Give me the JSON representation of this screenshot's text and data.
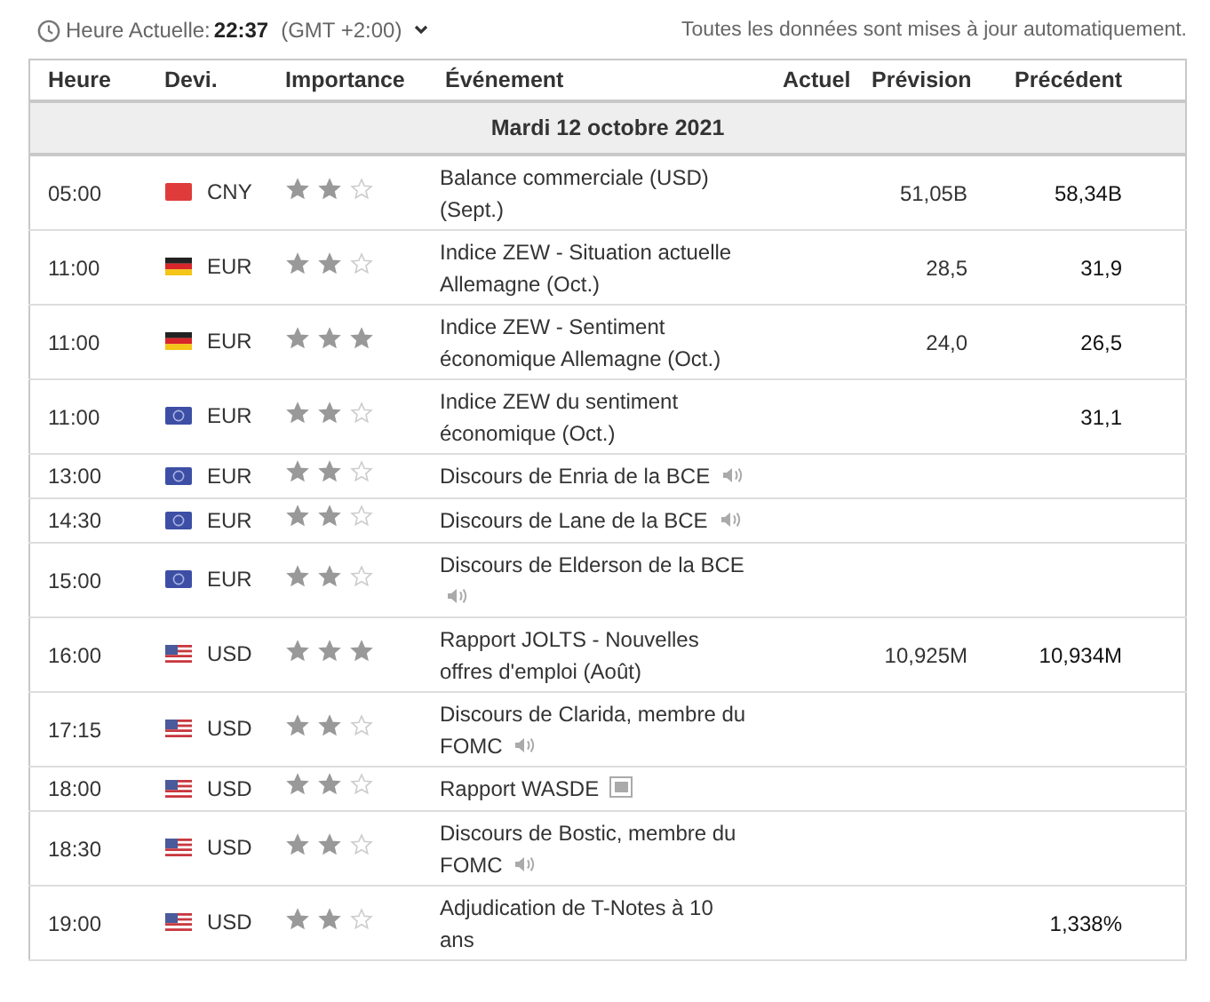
{
  "top_bar": {
    "clock_label": "Heure Actuelle:",
    "time": "22:37",
    "timezone": "(GMT +2:00)",
    "notice": "Toutes les données sont mises à jour automatiquement."
  },
  "table": {
    "columns": [
      "Heure",
      "Devi.",
      "Importance",
      "Événement",
      "Actuel",
      "Prévision",
      "Précédent"
    ],
    "date_header": "Mardi 12 octobre 2021",
    "rows": [
      {
        "time": "05:00",
        "currency": {
          "code": "CNY",
          "kind": "china"
        },
        "stars": 2,
        "event": {
          "text": "Balance commerciale (USD) (Sept.)",
          "kind": "plain"
        },
        "forecast": "51,05B",
        "previous": "58,34B"
      },
      {
        "time": "11:00",
        "currency": {
          "code": "EUR",
          "kind": "germany"
        },
        "stars": 2,
        "event": {
          "text": "Indice ZEW - Situation actuelle Allemagne (Oct.)",
          "kind": "plain"
        },
        "forecast": "28,5",
        "previous": "31,9"
      },
      {
        "time": "11:00",
        "currency": {
          "code": "EUR",
          "kind": "germany"
        },
        "stars": 3,
        "event": {
          "text": "Indice ZEW - Sentiment économique Allemagne (Oct.)",
          "kind": "plain"
        },
        "forecast": "24,0",
        "previous": "26,5"
      },
      {
        "time": "11:00",
        "currency": {
          "code": "EUR",
          "kind": "eu"
        },
        "stars": 2,
        "event": {
          "text": "Indice ZEW du sentiment économique (Oct.)",
          "kind": "plain"
        },
        "previous": "31,1"
      },
      {
        "time": "13:00",
        "currency": {
          "code": "EUR",
          "kind": "eu"
        },
        "stars": 2,
        "event": {
          "text": "Discours de Enria de la BCE",
          "kind": "speech"
        }
      },
      {
        "time": "14:30",
        "currency": {
          "code": "EUR",
          "kind": "eu"
        },
        "stars": 2,
        "event": {
          "text": "Discours de Lane de la BCE",
          "kind": "speech"
        }
      },
      {
        "time": "15:00",
        "currency": {
          "code": "EUR",
          "kind": "eu"
        },
        "stars": 2,
        "event": {
          "text": "Discours de Elderson de la BCE",
          "kind": "speech"
        }
      },
      {
        "time": "16:00",
        "currency": {
          "code": "USD",
          "kind": "usa"
        },
        "stars": 3,
        "event": {
          "text": "Rapport JOLTS - Nouvelles offres d'emploi (Août)",
          "kind": "plain"
        },
        "forecast": "10,925M",
        "previous": "10,934M"
      },
      {
        "time": "17:15",
        "currency": {
          "code": "USD",
          "kind": "usa"
        },
        "stars": 2,
        "event": {
          "text": "Discours de Clarida, membre du FOMC",
          "kind": "speech"
        }
      },
      {
        "time": "18:00",
        "currency": {
          "code": "USD",
          "kind": "usa"
        },
        "stars": 2,
        "event": {
          "text": "Rapport WASDE",
          "kind": "report"
        }
      },
      {
        "time": "18:30",
        "currency": {
          "code": "USD",
          "kind": "usa"
        },
        "stars": 2,
        "event": {
          "text": "Discours de Bostic, membre du FOMC",
          "kind": "speech"
        }
      },
      {
        "time": "19:00",
        "currency": {
          "code": "USD",
          "kind": "usa"
        },
        "stars": 2,
        "event": {
          "text": "Adjudication de T-Notes à 10 ans",
          "kind": "plain"
        },
        "previous": "1,338%"
      }
    ]
  }
}
